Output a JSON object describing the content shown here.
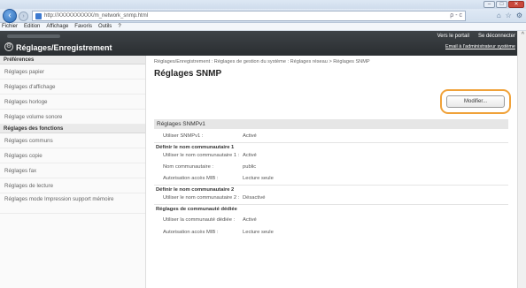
{
  "browser": {
    "address": "http://XXXXXXXXXX/m_network_snmp.html",
    "address_tools": "ρ - c",
    "menu": [
      "Fichier",
      "Edition",
      "Affichage",
      "Favoris",
      "Outils",
      "?"
    ]
  },
  "header": {
    "title": "Réglages/Enregistrement",
    "portal_link": "Vers le portail",
    "logout_link": "Se déconnecter",
    "admin_mail_link": "Email à l'administrateur système"
  },
  "sidebar": {
    "sections": [
      {
        "heading": "Préférences",
        "items": [
          "Réglages papier",
          "Réglages d'affichage",
          "Réglages horloge",
          "Réglage volume sonore"
        ]
      },
      {
        "heading": "Réglages des fonctions",
        "items": [
          "Réglages communs",
          "Réglages copie",
          "Réglages fax",
          "Réglages de lecture",
          "Réglages mode Impression support mémoire"
        ]
      }
    ]
  },
  "main": {
    "breadcrumb": "Réglages/Enregistrement : Réglages de gestion du système : Réglages réseau > Réglages SNMP",
    "title": "Réglages SNMP",
    "edit_button": "Modifier...",
    "snmpv1": {
      "heading": "Réglages SNMPv1",
      "use_label": "Utiliser SNMPv1 :",
      "use_value": "Activé",
      "community1_heading": "Définir le nom communautaire 1",
      "community1_rows": [
        {
          "label": "Utiliser le nom communautaire 1 :",
          "value": "Activé"
        },
        {
          "label": "Nom communautaire :",
          "value": "public"
        },
        {
          "label": "Autorisation accès MIB :",
          "value": "Lecture seule"
        }
      ],
      "community2_heading": "Définir le nom communautaire 2",
      "community2_rows": [
        {
          "label": "Utiliser le nom communautaire 2 :",
          "value": "Désactivé"
        }
      ],
      "dedicated_heading": "Réglages de communauté dédiée",
      "dedicated_rows": [
        {
          "label": "Utiliser la communauté dédiée :",
          "value": "Activé"
        },
        {
          "label": "Autorisation accès MIB :",
          "value": "Lecture seule"
        }
      ]
    }
  },
  "colors": {
    "header_bg": "#2e3235",
    "highlight_ring": "#f0a23a",
    "section_bg": "#e6e6e6"
  }
}
